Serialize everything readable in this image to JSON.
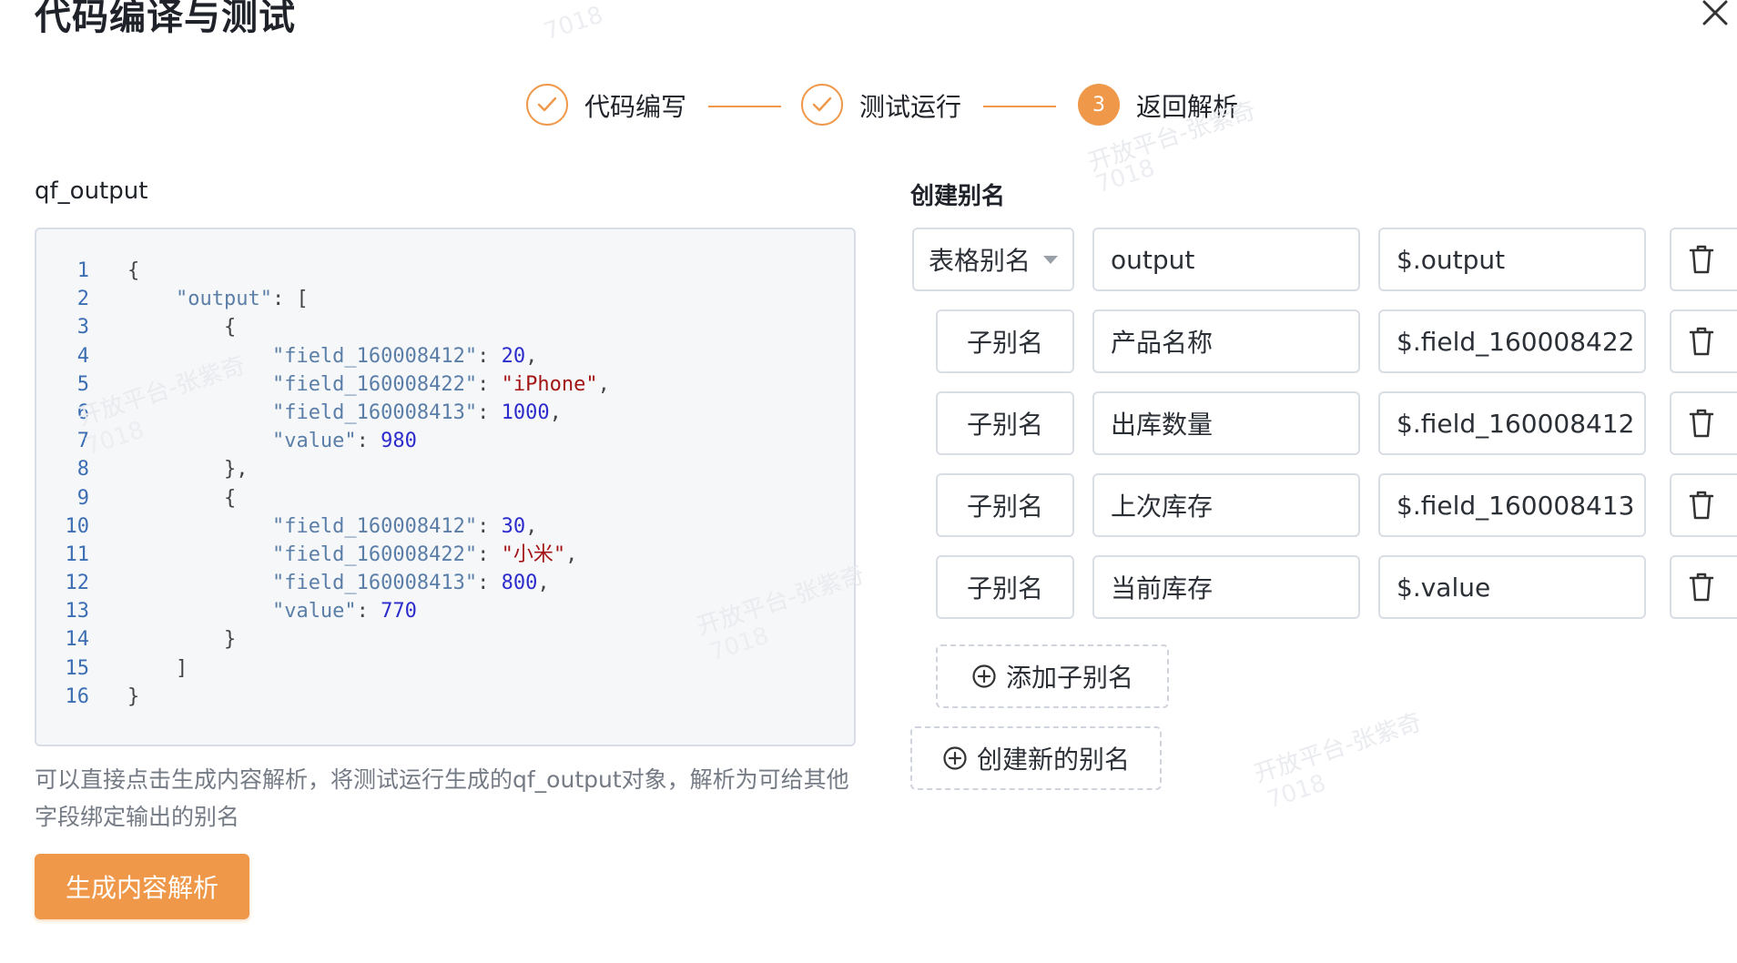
{
  "dialog": {
    "title": "代码编译与测试"
  },
  "steps": [
    {
      "label": "代码编写",
      "status": "done"
    },
    {
      "label": "测试运行",
      "status": "done"
    },
    {
      "label": "返回解析",
      "status": "active",
      "number": "3"
    }
  ],
  "left": {
    "output_label": "qf_output",
    "code_lines": [
      {
        "n": "1",
        "text": "{"
      },
      {
        "n": "2",
        "text": "    \"output\": ["
      },
      {
        "n": "3",
        "text": "        {"
      },
      {
        "n": "4",
        "text": "            \"field_160008412\": 20,"
      },
      {
        "n": "5",
        "text": "            \"field_160008422\": \"iPhone\","
      },
      {
        "n": "6",
        "text": "            \"field_160008413\": 1000,"
      },
      {
        "n": "7",
        "text": "            \"value\": 980"
      },
      {
        "n": "8",
        "text": "        },"
      },
      {
        "n": "9",
        "text": "        {"
      },
      {
        "n": "10",
        "text": "            \"field_160008412\": 30,"
      },
      {
        "n": "11",
        "text": "            \"field_160008422\": \"小米\","
      },
      {
        "n": "12",
        "text": "            \"field_160008413\": 800,"
      },
      {
        "n": "13",
        "text": "            \"value\": 770"
      },
      {
        "n": "14",
        "text": "        }"
      },
      {
        "n": "15",
        "text": "    ]"
      },
      {
        "n": "16",
        "text": "}"
      }
    ],
    "hint": "可以直接点击生成内容解析，将测试运行生成的qf_output对象，解析为可给其他字段绑定输出的别名",
    "generate_button": "生成内容解析"
  },
  "right": {
    "title": "创建别名",
    "table_alias": {
      "type_label": "表格别名",
      "name": "output",
      "path": "$.output"
    },
    "sub_aliases": [
      {
        "type_label": "子别名",
        "name": "产品名称",
        "path": "$.field_160008422"
      },
      {
        "type_label": "子别名",
        "name": "出库数量",
        "path": "$.field_160008412"
      },
      {
        "type_label": "子别名",
        "name": "上次库存",
        "path": "$.field_160008413"
      },
      {
        "type_label": "子别名",
        "name": "当前库存",
        "path": "$.value"
      }
    ],
    "add_sub_alias_button": "添加子别名",
    "create_alias_button": "创建新的别名"
  },
  "watermark": {
    "text": "开放平台-张紫奇",
    "id_text": "7018"
  },
  "colors": {
    "accent": "#ef9849",
    "border": "#d9dde4",
    "code_bg": "#f6f7f9"
  },
  "icons": [
    "close-icon",
    "check-icon",
    "caret-down-icon",
    "trash-icon",
    "plus-circle-icon"
  ]
}
